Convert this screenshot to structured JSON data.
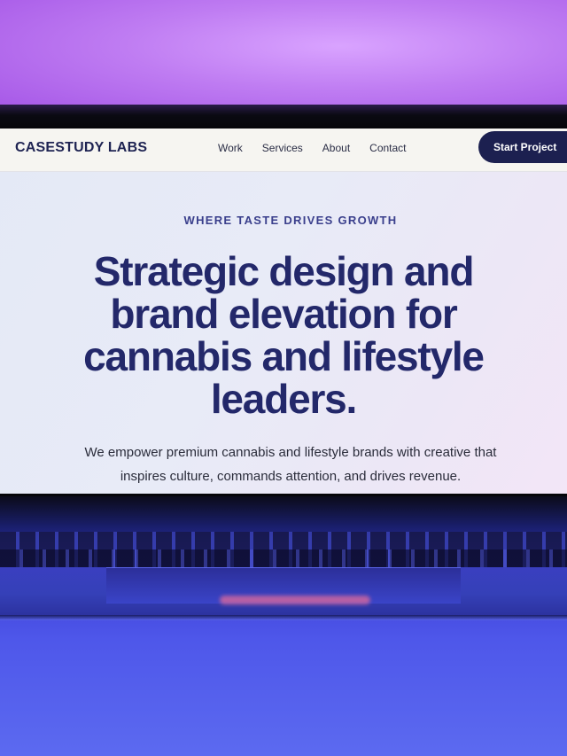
{
  "site": {
    "logo": "CASESTUDY LABS",
    "nav": [
      {
        "label": "Work"
      },
      {
        "label": "Services"
      },
      {
        "label": "About"
      },
      {
        "label": "Contact"
      }
    ],
    "cta_label": "Start Project"
  },
  "hero": {
    "eyebrow": "WHERE TASTE DRIVES GROWTH",
    "headline": "Strategic design and brand elevation for cannabis and lifestyle leaders.",
    "subtext": "We empower premium cannabis and lifestyle brands with creative that inspires culture, commands attention, and drives revenue."
  },
  "colors": {
    "brand_navy": "#1c2050",
    "headline": "#23286a",
    "backdrop_purple": "#bf7cf2",
    "backdrop_blue": "#4e57ea"
  }
}
